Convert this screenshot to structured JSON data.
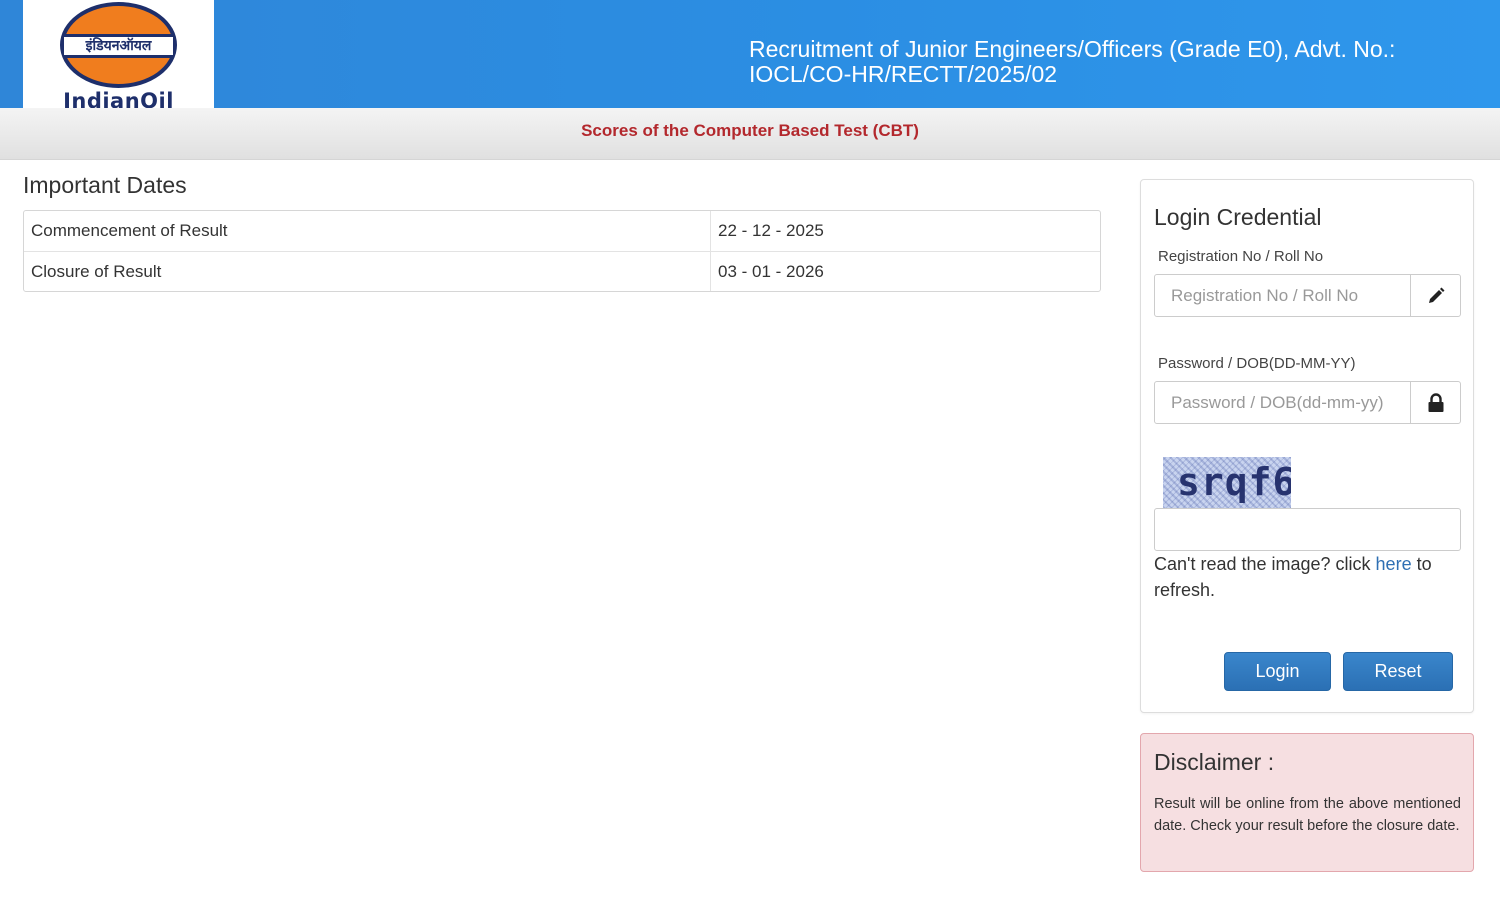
{
  "header": {
    "logo_hindi": "इंडियनऑयल",
    "logo_text": "IndianOil",
    "title": "Recruitment of Junior Engineers/Officers (Grade E0), Advt. No.: IOCL/CO-HR/RECTT/2025/02"
  },
  "subheader": {
    "title": "Scores of the Computer Based Test (CBT)"
  },
  "important_dates": {
    "heading": "Important Dates",
    "rows": [
      {
        "label": "Commencement of Result",
        "value": "22 - 12 - 2025"
      },
      {
        "label": "Closure of Result",
        "value": "03 - 01 - 2026"
      }
    ]
  },
  "login": {
    "title": "Login Credential",
    "registration_label": "Registration No / Roll No",
    "registration_placeholder": "Registration No / Roll No",
    "registration_value": "",
    "password_label": "Password / DOB(DD-MM-YY)",
    "password_placeholder": "Password / DOB(dd-mm-yy)",
    "password_value": "",
    "captcha_text": "srqf6",
    "captcha_value": "",
    "refresh_prefix": "Can't read the image? click ",
    "refresh_link": "here",
    "refresh_suffix": " to refresh.",
    "login_button": "Login",
    "reset_button": "Reset",
    "icons": {
      "registration": "pencil-icon",
      "password": "lock-icon"
    }
  },
  "disclaimer": {
    "title": "Disclaimer :",
    "text": "Result will be online from the above mentioned date. Check your result before the closure date."
  },
  "colors": {
    "header_blue": "#2b8ee3",
    "subheader_red": "#b3282d",
    "button_blue": "#2b70b4",
    "disclaimer_bg": "#f6dfe1",
    "logo_orange": "#f07d1e",
    "logo_navy": "#1e2f6b"
  }
}
